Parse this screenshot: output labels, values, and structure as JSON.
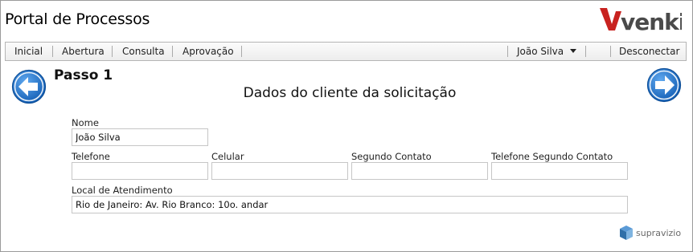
{
  "header": {
    "title": "Portal de Processos",
    "logo_text": "venki"
  },
  "nav": {
    "items": [
      "Inicial",
      "Abertura",
      "Consulta",
      "Aprovação"
    ],
    "user": "João Silva",
    "logout": "Desconectar"
  },
  "step": {
    "label": "Passo 1",
    "title": "Dados do cliente da solicitação"
  },
  "form": {
    "nome": {
      "label": "Nome",
      "value": "João Silva"
    },
    "telefone": {
      "label": "Telefone",
      "value": ""
    },
    "celular": {
      "label": "Celular",
      "value": ""
    },
    "segundo_contato": {
      "label": "Segundo Contato",
      "value": ""
    },
    "telefone_segundo": {
      "label": "Telefone Segundo Contato",
      "value": ""
    },
    "local": {
      "label": "Local de Atendimento",
      "value": "Rio de Janeiro: Av. Rio Branco: 10o. andar"
    }
  },
  "footer": {
    "brand": "supravizio"
  },
  "colors": {
    "arrow_blue": "#1a6fc9",
    "logo_red": "#c8221f",
    "logo_gray": "#4a4a4a"
  },
  "icons": {
    "back": "arrow-left-circle",
    "next": "arrow-right-circle"
  }
}
